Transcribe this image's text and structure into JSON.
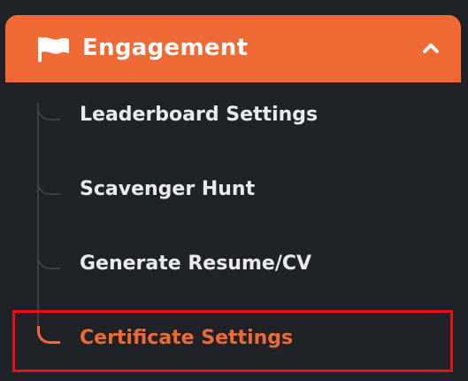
{
  "menu": {
    "header": {
      "label": "Engagement",
      "icon": "flag-icon",
      "toggle_icon": "chevron-up-icon",
      "expanded": true
    },
    "items": [
      {
        "label": "Leaderboard Settings",
        "active": false
      },
      {
        "label": "Scavenger Hunt",
        "active": false
      },
      {
        "label": "Generate Resume/CV",
        "active": false
      },
      {
        "label": "Certificate Settings",
        "active": true
      }
    ]
  },
  "colors": {
    "accent": "#f06a35",
    "background": "#1f2328",
    "text": "#e8eaed",
    "highlight": "#e81010"
  }
}
